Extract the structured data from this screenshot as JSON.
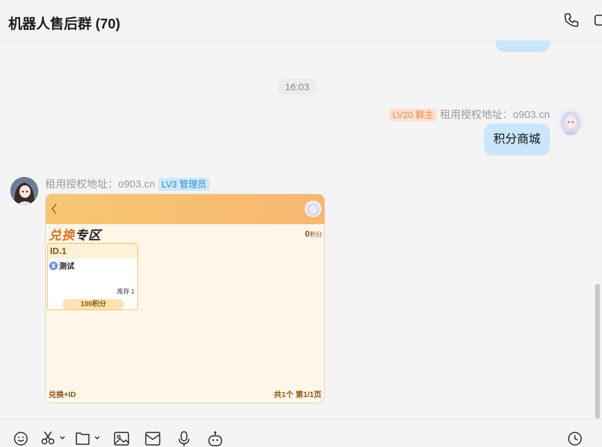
{
  "header": {
    "title": "机器人售后群 (70)"
  },
  "timestamp": "16:03",
  "messages": [
    {
      "sender_name": "租用授权地址：o903.cn",
      "badge": "LV20 群主",
      "text": "积分商城"
    },
    {
      "sender_name": "租用授权地址：o903.cn",
      "badge": "LV3 管理员",
      "card": {
        "title_part1": "兑换",
        "title_part2": "专区",
        "points_value": "0",
        "points_unit": "积分",
        "item": {
          "id": "ID.1",
          "name": "测试",
          "stock": "库存 1",
          "price": "100积分"
        },
        "footer_left": "兑换+ID",
        "footer_right": "共1个 第1/1页"
      }
    }
  ],
  "toolbar": [
    "emoji-icon",
    "scissors-icon",
    "folder-icon",
    "image-icon",
    "envelope-icon",
    "microphone-icon",
    "robot-icon",
    "clock-icon"
  ],
  "colors": {
    "bubble": "#c9e6fc",
    "owner_badge": "#f08a4b",
    "admin_badge": "#2a8fd6",
    "card_header": "#f6c772"
  }
}
